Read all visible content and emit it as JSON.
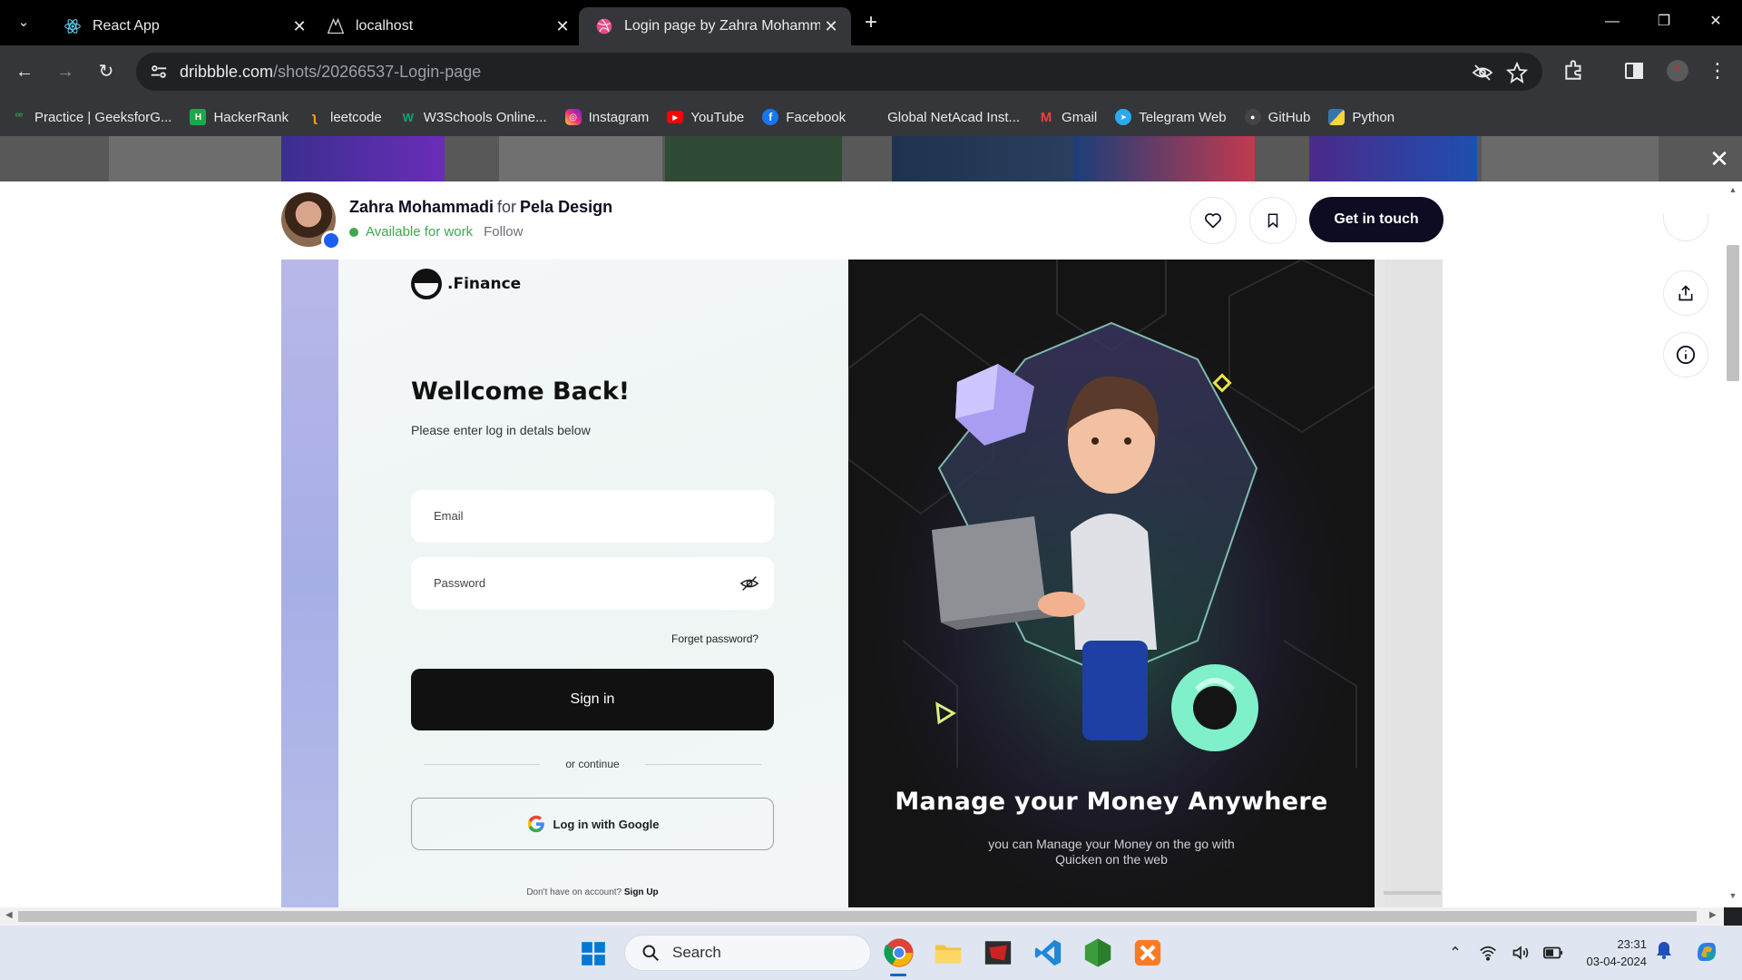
{
  "browser": {
    "tabs": [
      {
        "title": "React App",
        "icon": "react-icon"
      },
      {
        "title": "localhost",
        "icon": "localhost-icon"
      },
      {
        "title": "Login page by Zahra Mohamma",
        "icon": "dribbble-icon",
        "active": true
      }
    ],
    "url_host": "dribbble.com",
    "url_path": "/shots/20266537-Login-page",
    "bookmarks": [
      {
        "label": "Practice | GeeksforG...",
        "icon": "geeksforgeeks-icon",
        "color": "#2f8d46"
      },
      {
        "label": "HackerRank",
        "icon": "hackerrank-icon",
        "color": "#1ba94c"
      },
      {
        "label": "leetcode",
        "icon": "leetcode-icon",
        "color": "#ffa116"
      },
      {
        "label": "W3Schools Online...",
        "icon": "w3schools-icon",
        "color": "#04aa6d"
      },
      {
        "label": "Instagram",
        "icon": "instagram-icon",
        "color": "#d6249f"
      },
      {
        "label": "YouTube",
        "icon": "youtube-icon",
        "color": "#ff0000"
      },
      {
        "label": "Facebook",
        "icon": "facebook-icon",
        "color": "#1877f2"
      },
      {
        "label": "Global NetAcad Inst...",
        "icon": "netacad-icon",
        "color": "#35363a"
      },
      {
        "label": "Gmail",
        "icon": "gmail-icon",
        "color": "#ea4335"
      },
      {
        "label": "Telegram Web",
        "icon": "telegram-icon",
        "color": "#2aabee"
      },
      {
        "label": "GitHub",
        "icon": "github-icon",
        "color": "#444"
      },
      {
        "label": "Python",
        "icon": "python-icon",
        "color": "#3776ab"
      }
    ]
  },
  "shot": {
    "designer": "Zahra Mohammadi",
    "for_word": "for",
    "team": "Pela Design",
    "availability": "Available for work",
    "follow": "Follow",
    "cta": "Get in touch"
  },
  "design": {
    "logo_text": ".Finance",
    "heading": "Wellcome Back!",
    "subheading": "Please enter log in detals below",
    "email_placeholder": "Email",
    "password_placeholder": "Password",
    "forgot": "Forget password?",
    "signin": "Sign in",
    "or_continue": "or continue",
    "google": "Log in with Google",
    "signup_prompt": "Don't have on account?",
    "signup_link": "Sign Up",
    "hero_title": "Manage your Money Anywhere",
    "hero_sub_1": "you can Manage your Money on the go with",
    "hero_sub_2": "Quicken on the web"
  },
  "taskbar": {
    "search": "Search",
    "time": "23:31",
    "date": "03-04-2024"
  },
  "colors": {
    "accent_dark": "#0d0c22",
    "available_green": "#3ea84f",
    "hero_bg": "#141414"
  }
}
